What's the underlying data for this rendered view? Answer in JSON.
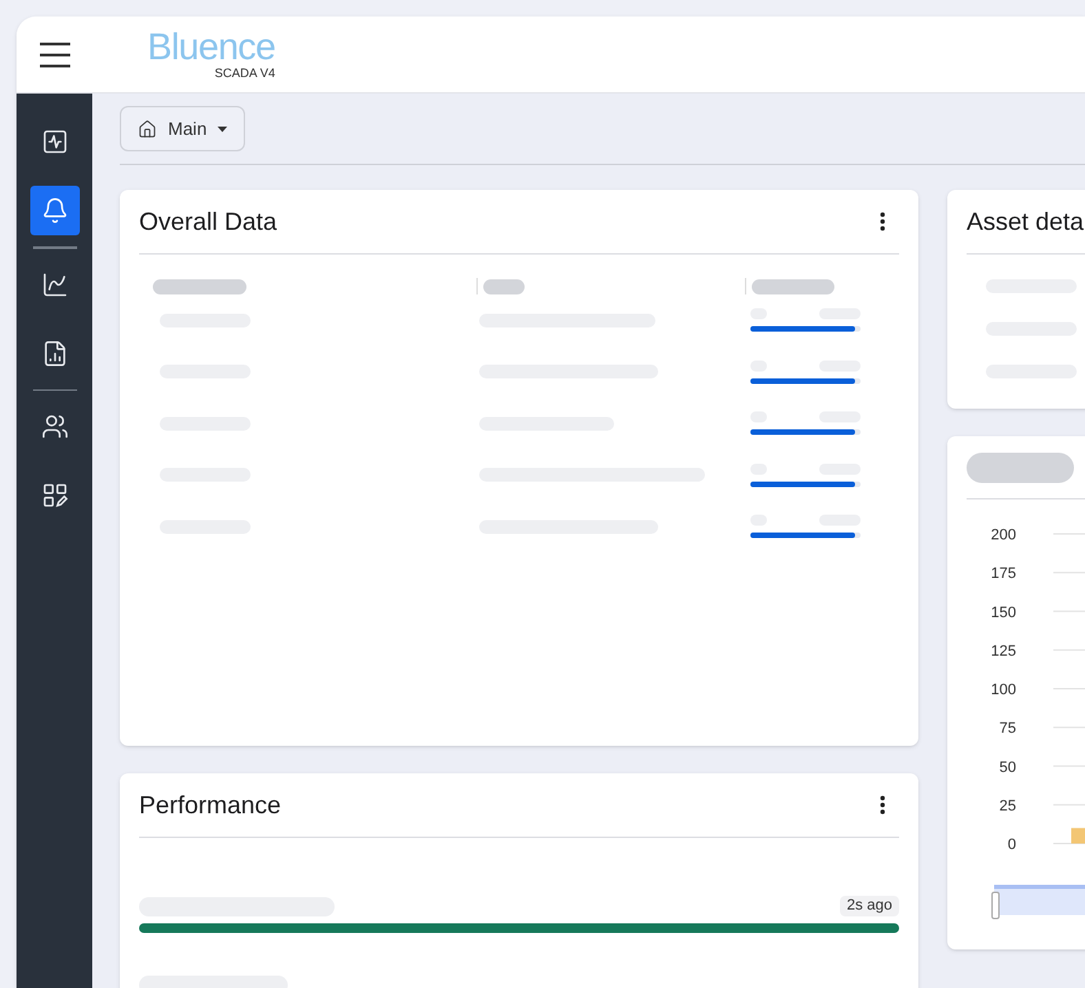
{
  "header": {
    "logo": "Bluence",
    "logo_subtitle": "SCADA V4"
  },
  "sidebar": {
    "groups": [
      {
        "items": [
          {
            "selected": false
          },
          {
            "selected": true
          }
        ]
      },
      {
        "items": [
          {
            "selected": false
          },
          {
            "selected": false
          }
        ]
      },
      {
        "items": [
          {
            "selected": false
          },
          {
            "selected": false
          }
        ]
      }
    ]
  },
  "breadcrumb": {
    "label": "Main"
  },
  "overall_data": {
    "title": "Overall Data",
    "rows": [
      {
        "level": 0.95
      },
      {
        "level": 0.95
      },
      {
        "level": 0.95
      },
      {
        "level": 0.95
      },
      {
        "level": 0.95
      }
    ]
  },
  "performance": {
    "title": "Performance",
    "items": [
      {
        "time": "2s ago",
        "level": 1
      }
    ]
  },
  "asset_details": {
    "title": "Asset deta"
  },
  "chart_panel": {
    "chart_data": {
      "type": "bar",
      "grid": true,
      "ylim": [
        0,
        200
      ],
      "yticks": [
        0,
        25,
        50,
        75,
        100,
        125,
        150,
        175,
        200
      ],
      "series": [
        {
          "color": "#f3c674",
          "values": [
            10
          ]
        }
      ]
    }
  }
}
